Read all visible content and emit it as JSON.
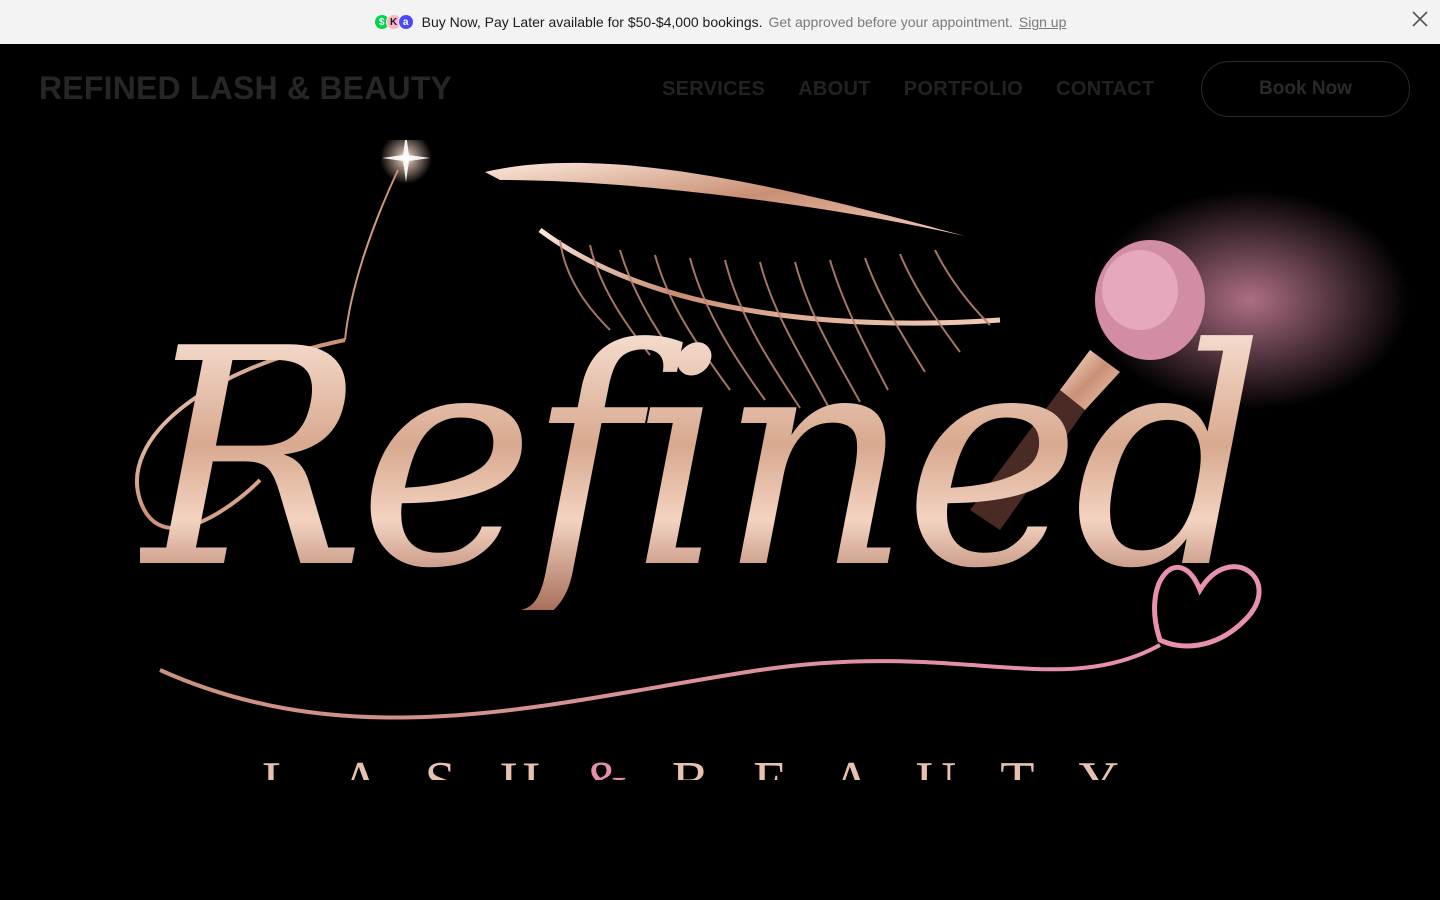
{
  "promo": {
    "headline": "Buy Now, Pay Later available for $50-$4,000 bookings.",
    "subtext": "Get approved before your appointment.",
    "link": "Sign up",
    "payment_icons": [
      {
        "name": "cash-app-icon",
        "glyph": "$"
      },
      {
        "name": "klarna-icon",
        "glyph": "K"
      },
      {
        "name": "affirm-icon",
        "glyph": "a"
      }
    ],
    "close_icon": "close-icon"
  },
  "header": {
    "brand": "REFINED LASH & BEAUTY",
    "nav": [
      {
        "label": "SERVICES"
      },
      {
        "label": "ABOUT"
      },
      {
        "label": "PORTFOLIO"
      },
      {
        "label": "CONTACT"
      }
    ],
    "cta": "Book Now"
  },
  "hero": {
    "logo_word": "Refined",
    "logo_sub_left": "LASH",
    "logo_sub_amp": "&",
    "logo_sub_right": "BEAUTY"
  },
  "colors": {
    "promo_bg": "#f3f3f3",
    "page_bg": "#000000",
    "rose_gold": "#d8a98f",
    "pink_accent": "#e58fae"
  }
}
